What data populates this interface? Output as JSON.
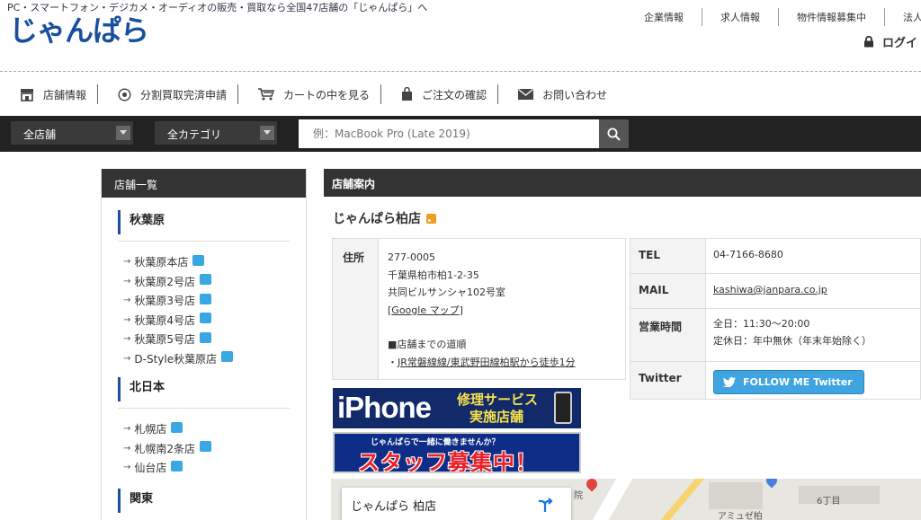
{
  "header": {
    "tagline": "PC・スマートフォン・デジカメ・オーディオの販売・買取なら全国47店舗の「じゃんぱら」へ",
    "logo_text": "じゃんぱら",
    "corp_links": [
      "企業情報",
      "求人情報",
      "物件情報募集中",
      "法人"
    ],
    "login_label": "ログイ"
  },
  "subnav": {
    "items": [
      {
        "label": "店舗情報",
        "icon": "store-icon"
      },
      {
        "label": "分割買取完済申請",
        "icon": "circle-dot-icon"
      },
      {
        "label": "カートの中を見る",
        "icon": "cart-icon"
      },
      {
        "label": "ご注文の確認",
        "icon": "bag-icon"
      },
      {
        "label": "お問い合わせ",
        "icon": "mail-icon"
      }
    ]
  },
  "search": {
    "store_select": "全店舗",
    "category_select": "全カテゴリ",
    "placeholder": "例：MacBook Pro (Late 2019)"
  },
  "sidebar": {
    "title": "店舗一覧",
    "regions": [
      {
        "name": "秋葉原",
        "stores": [
          "秋葉原本店",
          "秋葉原2号店",
          "秋葉原3号店",
          "秋葉原4号店",
          "秋葉原5号店",
          "D-Style秋葉原店"
        ]
      },
      {
        "name": "北日本",
        "stores": [
          "札幌店",
          "札幌南2条店",
          "仙台店"
        ]
      },
      {
        "name": "関東",
        "stores": []
      }
    ]
  },
  "main": {
    "section_title": "店舗案内",
    "store_name": "じゃんぱら柏店",
    "address": {
      "label": "住所",
      "postal": "277-0005",
      "line1": "千葉県柏市柏1-2-35",
      "line2": "共同ビルサンシャ102号室",
      "map_link": "[Google マップ]",
      "route_heading": "■店舗までの道順",
      "route_prefix": "・",
      "route_link": "JR常磐線線/東武野田線柏駅から徒歩1分"
    },
    "info": {
      "tel_label": "TEL",
      "tel": "04-7166-8680",
      "mail_label": "MAIL",
      "mail": "kashiwa@janpara.co.jp",
      "hours_label": "営業時間",
      "hours": "全日：11:30〜20:00",
      "holiday": "定休日：年中無休（年末年始除く）",
      "twitter_label": "Twitter",
      "twitter_button": "FOLLOW ME Twitter"
    },
    "banner_iphone": {
      "big": "iPhone",
      "line1": "修理サービス",
      "line2": "実施店舗"
    },
    "banner_staff": {
      "small": "じゃんぱらで一緒に働きませんか？",
      "big": "スタッフ募集中！"
    },
    "map": {
      "card_title": "じゃんぱら 柏店",
      "labels": [
        "院",
        "6丁目",
        "アミュゼ柏"
      ]
    }
  },
  "colors": {
    "brand_blue": "#1a4fa0",
    "dark_bar": "#222222",
    "twitter": "#3fa4e0"
  }
}
